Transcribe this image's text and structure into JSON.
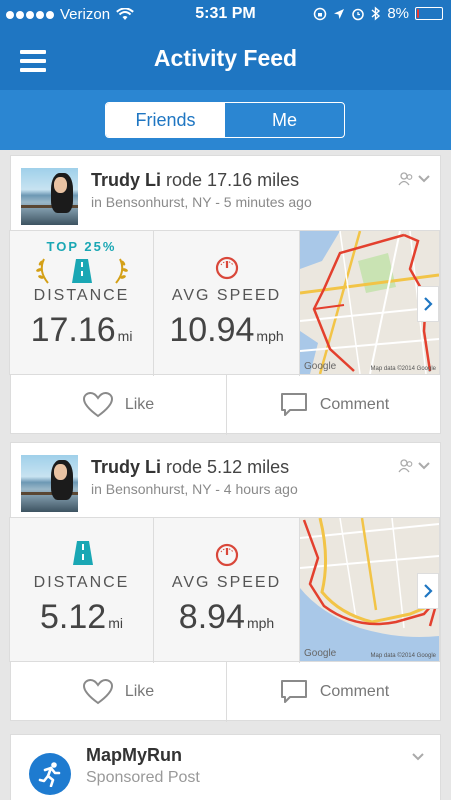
{
  "status_bar": {
    "carrier": "Verizon",
    "time": "5:31 PM",
    "battery_text": "8%",
    "battery_level": 0.08,
    "signal_bars_filled": 5
  },
  "nav": {
    "title": "Activity Feed",
    "menu_icon": "hamburger-menu-icon"
  },
  "segments": {
    "friends": "Friends",
    "me": "Me",
    "selected": "Friends"
  },
  "posts": [
    {
      "user": "Trudy Li",
      "action": "rode 17.16 miles",
      "location_time": "in Bensonhurst, NY - 5 minutes ago",
      "badge": "TOP 25%",
      "distance_label": "DISTANCE",
      "distance_value": "17.16",
      "distance_unit": "mi",
      "speed_label": "AVG SPEED",
      "speed_value": "10.94",
      "speed_unit": "mph",
      "map_google": "Google",
      "map_credit": "Map data ©2014 Google",
      "like": "Like",
      "comment": "Comment"
    },
    {
      "user": "Trudy Li",
      "action": "rode 5.12 miles",
      "location_time": "in Bensonhurst, NY - 4 hours ago",
      "distance_label": "DISTANCE",
      "distance_value": "5.12",
      "distance_unit": "mi",
      "speed_label": "AVG SPEED",
      "speed_value": "8.94",
      "speed_unit": "mph",
      "map_google": "Google",
      "map_credit": "Map data ©2014 Google",
      "like": "Like",
      "comment": "Comment"
    }
  ],
  "sponsored": {
    "name": "MapMyRun",
    "subtitle": "Sponsored Post"
  },
  "colors": {
    "brand_blue": "#1f76c2",
    "teal": "#1aa7b4",
    "gold": "#d4a017",
    "speed_red": "#d9473a",
    "route_red": "#e3402e"
  }
}
